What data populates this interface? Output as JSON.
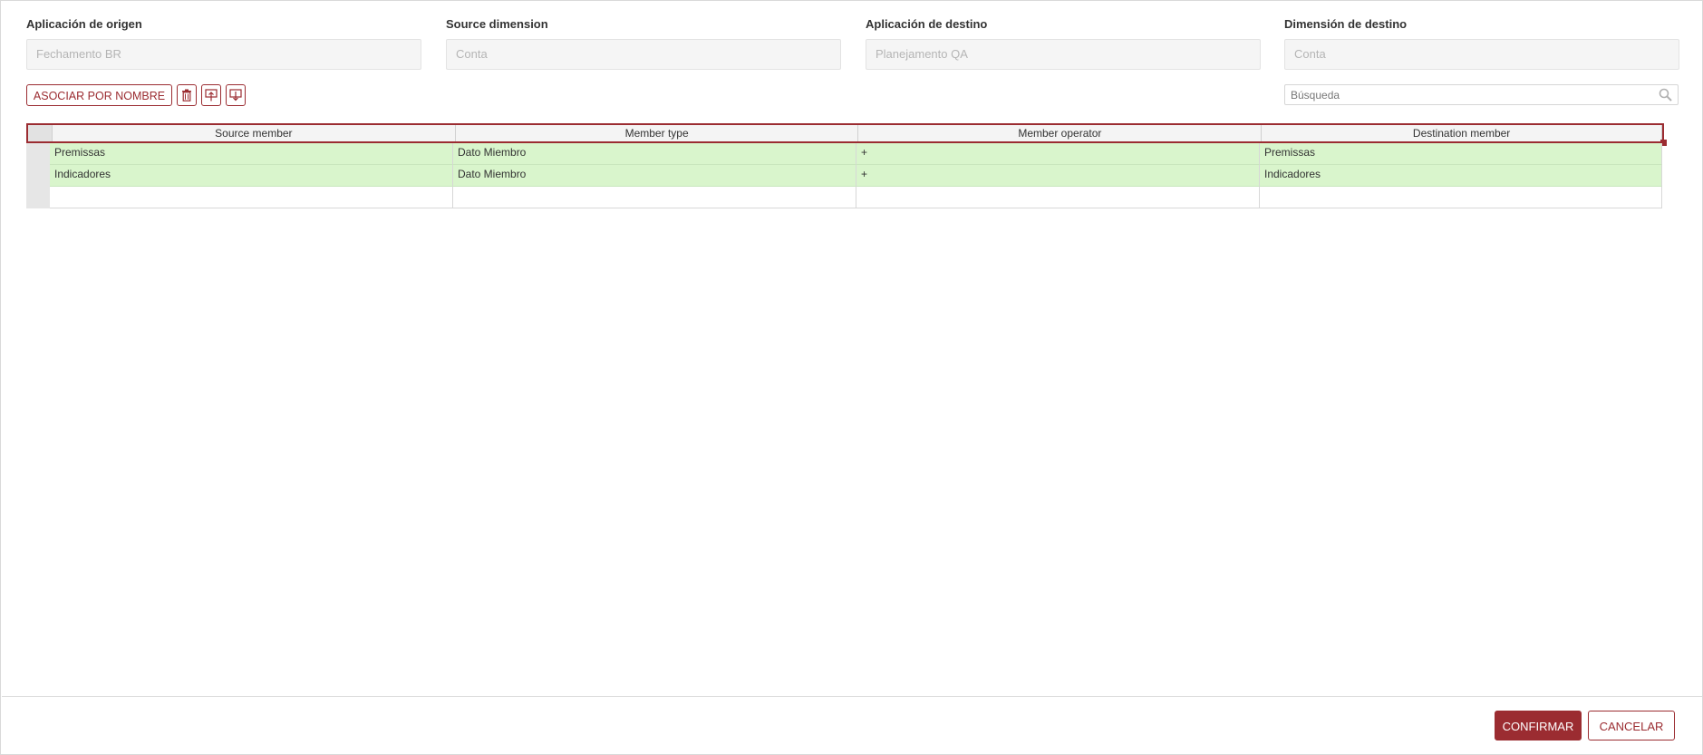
{
  "fields": [
    {
      "label": "Aplicación de origen",
      "value": "Fechamento BR"
    },
    {
      "label": "Source dimension",
      "value": "Conta"
    },
    {
      "label": "Aplicación de destino",
      "value": "Planejamento QA"
    },
    {
      "label": "Dimensión de destino",
      "value": "Conta"
    }
  ],
  "toolbar": {
    "associate_label": "ASOCIAR POR NOMBRE",
    "delete_icon": "trash-icon",
    "move_up_icon": "arrow-up-box-icon",
    "move_down_icon": "arrow-down-box-icon"
  },
  "search": {
    "placeholder": "Búsqueda",
    "icon": "search-icon"
  },
  "grid": {
    "columns": [
      "Source member",
      "Member type",
      "Member operator",
      "Destination member"
    ],
    "rows": [
      [
        "Premissas",
        "Dato Miembro",
        "+",
        "Premissas"
      ],
      [
        "Indicadores",
        "Dato Miembro",
        "+",
        "Indicadores"
      ]
    ]
  },
  "footer": {
    "confirm_label": "CONFIRMAR",
    "cancel_label": "CANCELAR"
  },
  "colors": {
    "accent": "#9b2c31",
    "row_fill": "#d9f5cc"
  }
}
